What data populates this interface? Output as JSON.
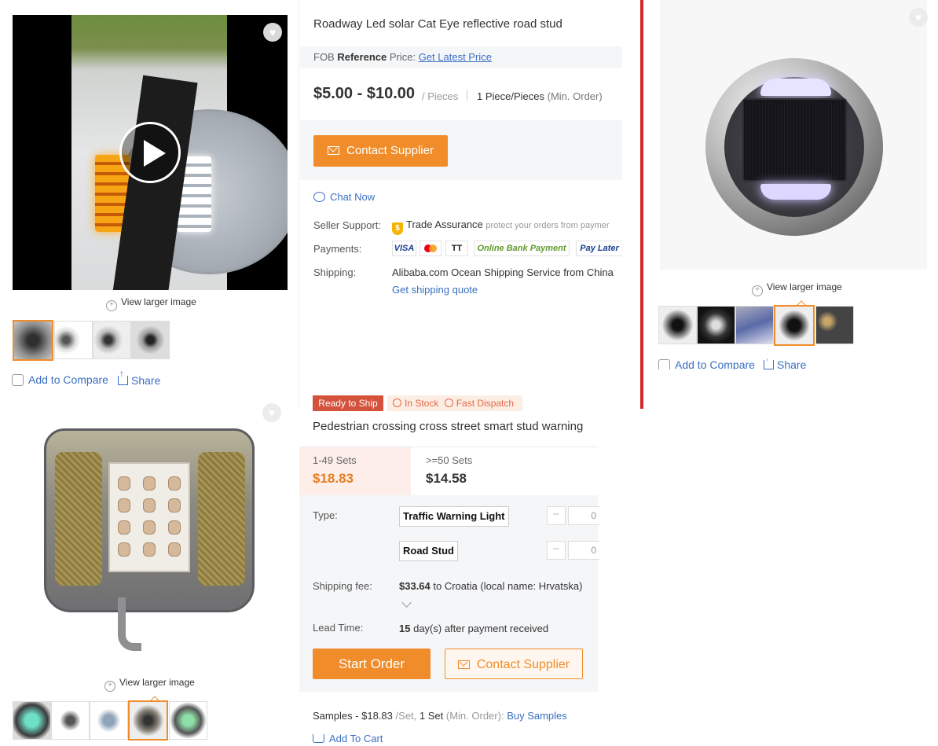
{
  "panel_a": {
    "view_larger": "View larger image",
    "add_to_compare": "Add to Compare",
    "share": "Share",
    "title": "Roadway Led solar Cat Eye reflective road stud",
    "fob_prefix": "FOB",
    "fob_reference": "Reference",
    "fob_price_word": "Price:",
    "get_latest_price": "Get Latest Price",
    "price_range": "$5.00 - $10.00",
    "price_unit": "/ Pieces",
    "min_order_qty": "1 Piece/Pieces",
    "min_order_label": "(Min. Order)",
    "contact_supplier": "Contact Supplier",
    "chat_now": "Chat Now",
    "seller_support_label": "Seller Support:",
    "trade_assurance": "Trade Assurance",
    "trade_assurance_note": "protect your orders from paymer",
    "payments_label": "Payments:",
    "payments": [
      "VISA",
      "TT",
      "Online Bank Payment",
      "Pay Later"
    ],
    "shipping_label": "Shipping:",
    "shipping_service": "Alibaba.com Ocean Shipping Service from China",
    "shipping_quote": "Get shipping quote"
  },
  "panel_b": {
    "view_larger": "View larger image",
    "add_to_compare": "Add to Compare",
    "share": "Share"
  },
  "panel_c": {
    "view_larger": "View larger image",
    "badge_ready": "Ready to Ship",
    "badge_in_stock": "In Stock",
    "badge_fast_dispatch": "Fast Dispatch",
    "title": "Pedestrian crossing cross street smart stud warning",
    "tiers": [
      {
        "qty": "1-49 Sets",
        "price": "$18.83"
      },
      {
        "qty": ">=50 Sets",
        "price": "$14.58"
      }
    ],
    "type_label": "Type:",
    "types": [
      {
        "name": "Traffic Warning Light",
        "qty": "0"
      },
      {
        "name": "Road Stud",
        "qty": "0"
      }
    ],
    "shipping_fee_label": "Shipping fee:",
    "shipping_fee": "$33.64",
    "shipping_dest": "to Croatia (local name: Hrvatska)",
    "lead_time_label": "Lead Time:",
    "lead_days": "15",
    "lead_text": "day(s) after payment received",
    "start_order": "Start Order",
    "contact_supplier": "Contact Supplier",
    "samples_prefix": "Samples - $18.83",
    "samples_unit": "/Set,",
    "samples_qty": "1 Set",
    "samples_min": "(Min. Order):",
    "buy_samples": "Buy Samples",
    "add_to_cart": "Add To Cart"
  },
  "colors": {
    "accent_orange": "#f08c29",
    "link_blue": "#3a6fc2",
    "badge_red": "#d4513b",
    "divider_red": "#d42a2a"
  }
}
